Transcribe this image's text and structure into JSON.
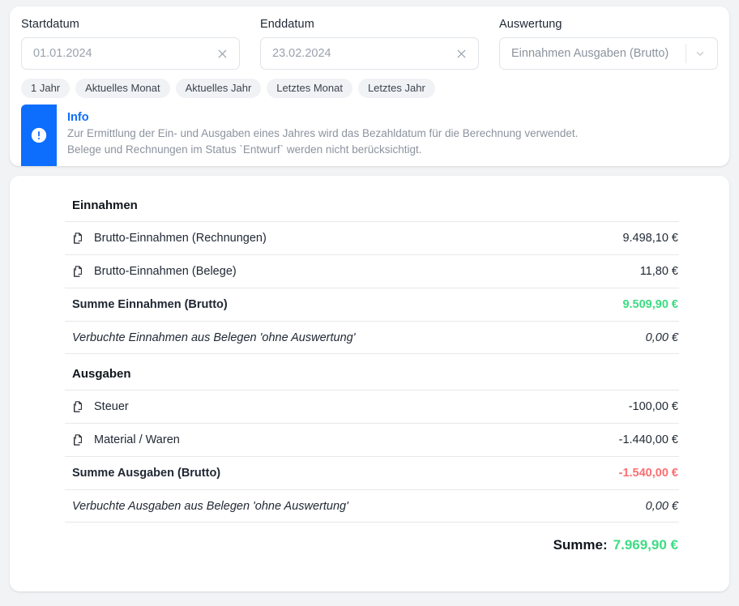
{
  "filters": {
    "start_date": {
      "label": "Startdatum",
      "value": "01.01.2024",
      "placeholder": "Startdatum",
      "clear_icon": "close-icon"
    },
    "end_date": {
      "label": "Enddatum",
      "value": "23.02.2024",
      "placeholder": "Enddatum",
      "clear_icon": "close-icon"
    },
    "evaluation": {
      "label": "Auswertung",
      "value": "Einnahmen Ausgaben (Brutto)",
      "chevron_icon": "chevron-down-icon"
    }
  },
  "quick_filters": [
    {
      "label": "1 Jahr"
    },
    {
      "label": "Aktuelles Monat"
    },
    {
      "label": "Aktuelles Jahr"
    },
    {
      "label": "Letztes Monat"
    },
    {
      "label": "Letztes Jahr"
    }
  ],
  "info": {
    "icon": "exclamation-circle-icon",
    "title": "Info",
    "line1": "Zur Ermittlung der Ein- und Ausgaben eines Jahres wird das Bezahldatum für die Berechnung verwendet.",
    "line2": "Belege und Rechnungen im Status `Entwurf` werden nicht berücksichtigt.",
    "accent_color": "#0d6efd"
  },
  "report": {
    "income": {
      "title": "Einnahmen",
      "rows": [
        {
          "icon": "documents-icon",
          "label": "Brutto-Einnahmen (Rechnungen)",
          "amount": "9.498,10 €"
        },
        {
          "icon": "documents-icon",
          "label": "Brutto-Einnahmen (Belege)",
          "amount": "11,80 €"
        }
      ],
      "total": {
        "label": "Summe Einnahmen (Brutto)",
        "amount": "9.509,90 €"
      },
      "note": {
        "label": "Verbuchte Einnahmen aus Belegen 'ohne Auswertung'",
        "amount": "0,00 €"
      }
    },
    "expenses": {
      "title": "Ausgaben",
      "rows": [
        {
          "icon": "documents-icon",
          "label": "Steuer",
          "amount": "-100,00 €"
        },
        {
          "icon": "documents-icon",
          "label": "Material / Waren",
          "amount": "-1.440,00 €"
        }
      ],
      "total": {
        "label": "Summe Ausgaben (Brutto)",
        "amount": "-1.540,00 €"
      },
      "note": {
        "label": "Verbuchte Ausgaben aus Belegen 'ohne Auswertung'",
        "amount": "0,00 €"
      }
    },
    "grand_total": {
      "label": "Summe:",
      "amount": "7.969,90 €"
    }
  },
  "colors": {
    "positive": "#3ddc84",
    "negative": "#fb6f72",
    "info_blue": "#0d6efd"
  }
}
